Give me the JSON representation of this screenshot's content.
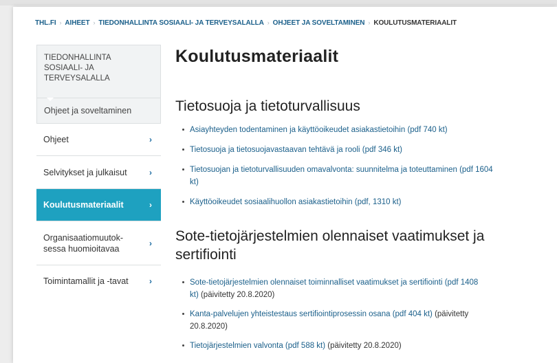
{
  "breadcrumb": {
    "items": [
      "THL.FI",
      "AIHEET",
      "TIEDONHALLINTA SOSIAALI- JA TERVEYSALALLA",
      "OHJEET JA SOVELTAMINEN"
    ],
    "current": "KOULUTUSMATERIAALIT",
    "separator": "›"
  },
  "sidebar": {
    "heading_lines": [
      "TIEDONHALLINTA",
      "SOSIAALI- JA",
      "TERVEYSALALLA"
    ],
    "subheading": "Ohjeet ja soveltaminen",
    "items": [
      {
        "lines": [
          "Ohjeet"
        ],
        "active": false
      },
      {
        "lines": [
          "Selvitykset ja julkaisut"
        ],
        "active": false
      },
      {
        "lines": [
          "Koulutusmateriaalit"
        ],
        "active": true
      },
      {
        "lines": [
          "Organisaatiomuutok-",
          "sessa huomioitavaa"
        ],
        "active": false
      },
      {
        "lines": [
          "Toimintamallit ja -tavat"
        ],
        "active": false
      }
    ],
    "chevron": "›",
    "active_color": "#1ea1c0"
  },
  "main": {
    "title": "Koulutusmateriaalit",
    "sections": [
      {
        "heading_lines": [
          "Tietosuoja ja tietoturvallisuus"
        ],
        "links": [
          {
            "lines": [
              "Asiayhteyden todentaminen ja käyttöoikeudet asiakastietoihin (pdf 740 kt)"
            ],
            "note": ""
          },
          {
            "lines": [
              "Tietosuoja ja tietosuojavastaavan tehtävä ja rooli (pdf 346 kt)"
            ],
            "note": ""
          },
          {
            "lines": [
              "Tietosuojan ja tietoturvallisuuden omavalvonta: suunnitelma ja toteuttaminen (pdf 1604",
              "kt)"
            ],
            "note": ""
          },
          {
            "lines": [
              "Käyttöoikeudet sosiaalihuollon asiakastietoihin (pdf, 1310 kt)"
            ],
            "note": ""
          }
        ]
      },
      {
        "heading_lines": [
          "Sote-tietojärjestelmien olennaiset vaatimukset ja",
          "sertifiointi"
        ],
        "links": [
          {
            "lines": [
              "Sote-tietojärjestelmien olennaiset toiminnalliset vaatimukset ja sertifiointi (pdf 1408",
              "kt)"
            ],
            "note": " (päivitetty 20.8.2020)"
          },
          {
            "lines": [
              "Kanta-palvelujen yhteistestaus sertifiointiprosessin osana (pdf 404 kt)"
            ],
            "note": " (päivitetty 20.8.2020)"
          },
          {
            "lines": [
              "Tietojärjestelmien valvonta (pdf 588 kt)"
            ],
            "note": " (päivitetty 20.8.2020)"
          }
        ]
      }
    ]
  }
}
